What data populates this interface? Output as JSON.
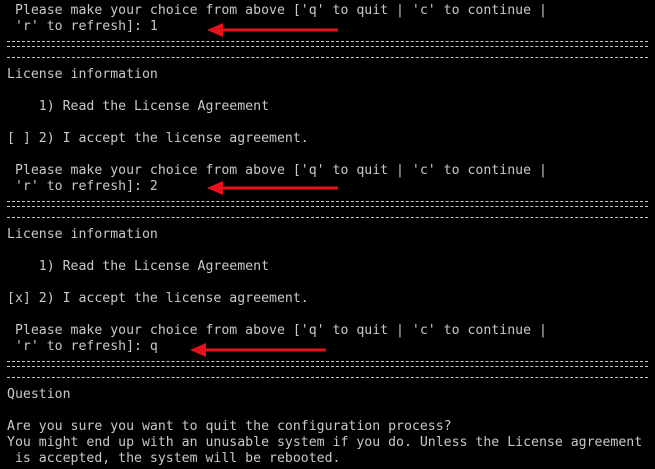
{
  "terminal": {
    "lines": {
      "l1": " Please make your choice from above ['q' to quit | 'c' to continue |",
      "l2": " 'r' to refresh]: 1",
      "l3": "License information",
      "l4": "    1) Read the License Agreement",
      "l5": "[ ] 2) I accept the license agreement.",
      "l6": " Please make your choice from above ['q' to quit | 'c' to continue |",
      "l7": " 'r' to refresh]: 2",
      "l8": "License information",
      "l9": "    1) Read the License Agreement",
      "l10": "[x] 2) I accept the license agreement.",
      "l11": " Please make your choice from above ['q' to quit | 'c' to continue |",
      "l12": " 'r' to refresh]: q",
      "l13": "Question",
      "l14": "Are you sure you want to quit the configuration process?",
      "l15": "You might end up with an unusable system if you do. Unless the License agreement",
      "l16": " is accepted, the system will be rebooted."
    },
    "arrow_color": "#e8101a",
    "text_color": "#c8c8c8",
    "background": "#000000"
  }
}
